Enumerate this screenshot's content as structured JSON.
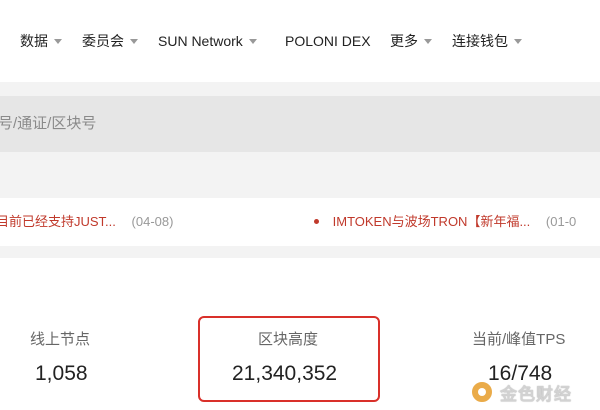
{
  "nav": {
    "items": [
      {
        "label": "数据",
        "has_dropdown": true
      },
      {
        "label": "委员会",
        "has_dropdown": true
      },
      {
        "label": "SUN Network",
        "has_dropdown": true
      },
      {
        "label": "POLONI DEX",
        "has_dropdown": false
      },
      {
        "label": "更多",
        "has_dropdown": true
      },
      {
        "label": "连接钱包",
        "has_dropdown": true
      }
    ]
  },
  "search": {
    "placeholder": "号/通证/区块号"
  },
  "news": [
    {
      "title": "目前已经支持JUST...",
      "date": "(04-08)"
    },
    {
      "title": "IMTOKEN与波场TRON【新年福...",
      "date": "(01-0"
    }
  ],
  "stats": [
    {
      "label": "线上节点",
      "value": "1,058"
    },
    {
      "label": "区块高度",
      "value": "21,340,352"
    },
    {
      "label": "当前/峰值TPS",
      "value": "16/748"
    }
  ],
  "watermark": {
    "text": "金色财经"
  },
  "colors": {
    "accent": "#c0392b",
    "highlight_border": "#d9302a",
    "band_bg": "#f3f3f3",
    "search_bg": "#e6e6e6"
  }
}
